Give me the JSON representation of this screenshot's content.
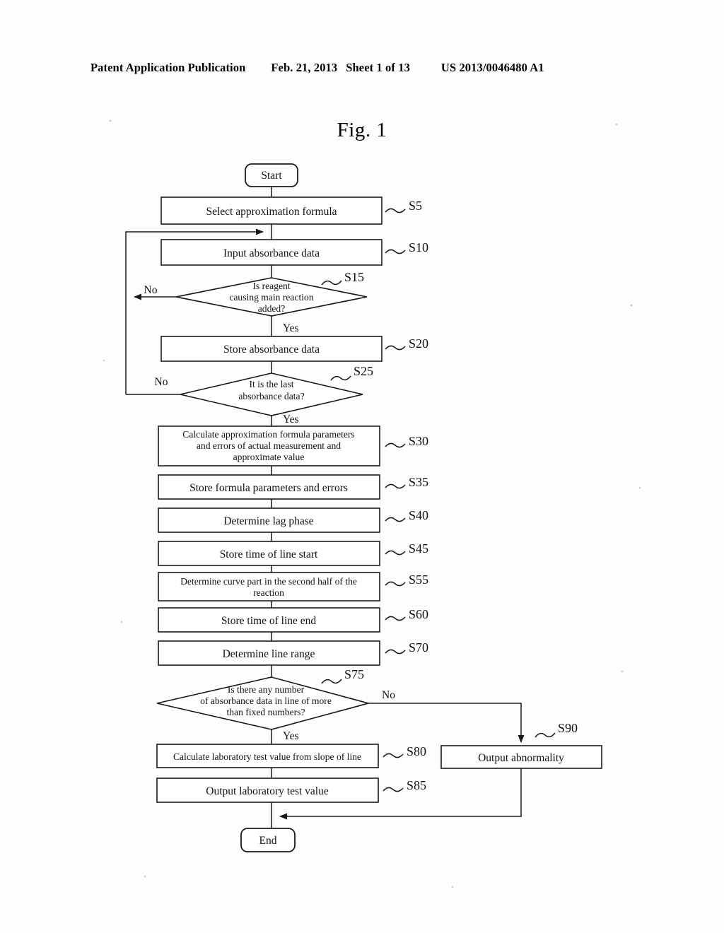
{
  "header": {
    "publication": "Patent Application Publication",
    "date": "Feb. 21, 2013",
    "sheet": "Sheet 1 of 13",
    "number": "US 2013/0046480 A1"
  },
  "figure": {
    "title": "Fig. 1"
  },
  "flowchart": {
    "terminators": {
      "start": "Start",
      "end": "End"
    },
    "nodes": [
      {
        "id": "S5",
        "type": "process",
        "label": "S5",
        "lines": [
          "Select approximation formula"
        ]
      },
      {
        "id": "S10",
        "type": "process",
        "label": "S10",
        "lines": [
          "Input absorbance data"
        ]
      },
      {
        "id": "S15",
        "type": "decision",
        "label": "S15",
        "lines": [
          "Is reagent",
          "causing main reaction",
          "added?"
        ],
        "yes": "Yes",
        "no": "No"
      },
      {
        "id": "S20",
        "type": "process",
        "label": "S20",
        "lines": [
          "Store absorbance data"
        ]
      },
      {
        "id": "S25",
        "type": "decision",
        "label": "S25",
        "lines": [
          "It is the last",
          "absorbance data?"
        ],
        "yes": "Yes",
        "no": "No"
      },
      {
        "id": "S30",
        "type": "process",
        "label": "S30",
        "lines": [
          "Calculate approximation formula parameters",
          "and errors of actual measurement and",
          "approximate value"
        ]
      },
      {
        "id": "S35",
        "type": "process",
        "label": "S35",
        "lines": [
          "Store formula parameters and errors"
        ]
      },
      {
        "id": "S40",
        "type": "process",
        "label": "S40",
        "lines": [
          "Determine lag phase"
        ]
      },
      {
        "id": "S45",
        "type": "process",
        "label": "S45",
        "lines": [
          "Store time of line start"
        ]
      },
      {
        "id": "S55",
        "type": "process",
        "label": "S55",
        "lines": [
          "Determine curve part in the second half of the",
          "reaction"
        ]
      },
      {
        "id": "S60",
        "type": "process",
        "label": "S60",
        "lines": [
          "Store time of line end"
        ]
      },
      {
        "id": "S70",
        "type": "process",
        "label": "S70",
        "lines": [
          "Determine line range"
        ]
      },
      {
        "id": "S75",
        "type": "decision",
        "label": "S75",
        "lines": [
          "Is there any number",
          "of absorbance data in line of more",
          "than fixed numbers?"
        ],
        "yes": "Yes",
        "no": "No"
      },
      {
        "id": "S80",
        "type": "process",
        "label": "S80",
        "lines": [
          "Calculate laboratory test value from slope of line"
        ]
      },
      {
        "id": "S85",
        "type": "process",
        "label": "S85",
        "lines": [
          "Output laboratory test value"
        ]
      },
      {
        "id": "S90",
        "type": "process",
        "label": "S90",
        "lines": [
          "Output abnormality"
        ]
      }
    ],
    "text": {
      "s5_line1": "Select approximation formula",
      "s10_line1": "Input absorbance data",
      "s15_line1": "Is reagent",
      "s15_line2": "causing main reaction",
      "s15_line3": "added?",
      "s15_yes": "Yes",
      "s15_no": "No",
      "s20_line1": "Store absorbance data",
      "s25_line1": "It is the last",
      "s25_line2": "absorbance data?",
      "s25_yes": "Yes",
      "s25_no": "No",
      "s30_line1": "Calculate approximation formula parameters",
      "s30_line2": "and errors of actual measurement and",
      "s30_line3": "approximate value",
      "s35_line1": "Store formula parameters and errors",
      "s40_line1": "Determine lag phase",
      "s45_line1": "Store time of line start",
      "s55_line1": "Determine curve part in the second half of the",
      "s55_line2": "reaction",
      "s60_line1": "Store time of line end",
      "s70_line1": "Determine line range",
      "s75_line1": "Is there any number",
      "s75_line2": "of absorbance data in line of more",
      "s75_line3": "than fixed numbers?",
      "s75_yes": "Yes",
      "s75_no": "No",
      "s80_line1": "Calculate laboratory test value from slope of line",
      "s85_line1": "Output laboratory test value",
      "s90_line1": "Output abnormality",
      "lbl_s5": "S5",
      "lbl_s10": "S10",
      "lbl_s15": "S15",
      "lbl_s20": "S20",
      "lbl_s25": "S25",
      "lbl_s30": "S30",
      "lbl_s35": "S35",
      "lbl_s40": "S40",
      "lbl_s45": "S45",
      "lbl_s55": "S55",
      "lbl_s60": "S60",
      "lbl_s70": "S70",
      "lbl_s75": "S75",
      "lbl_s80": "S80",
      "lbl_s85": "S85",
      "lbl_s90": "S90",
      "start": "Start",
      "end": "End"
    }
  },
  "colors": {
    "ink": "#1a1a1a",
    "paper": "#fdfdfc"
  }
}
